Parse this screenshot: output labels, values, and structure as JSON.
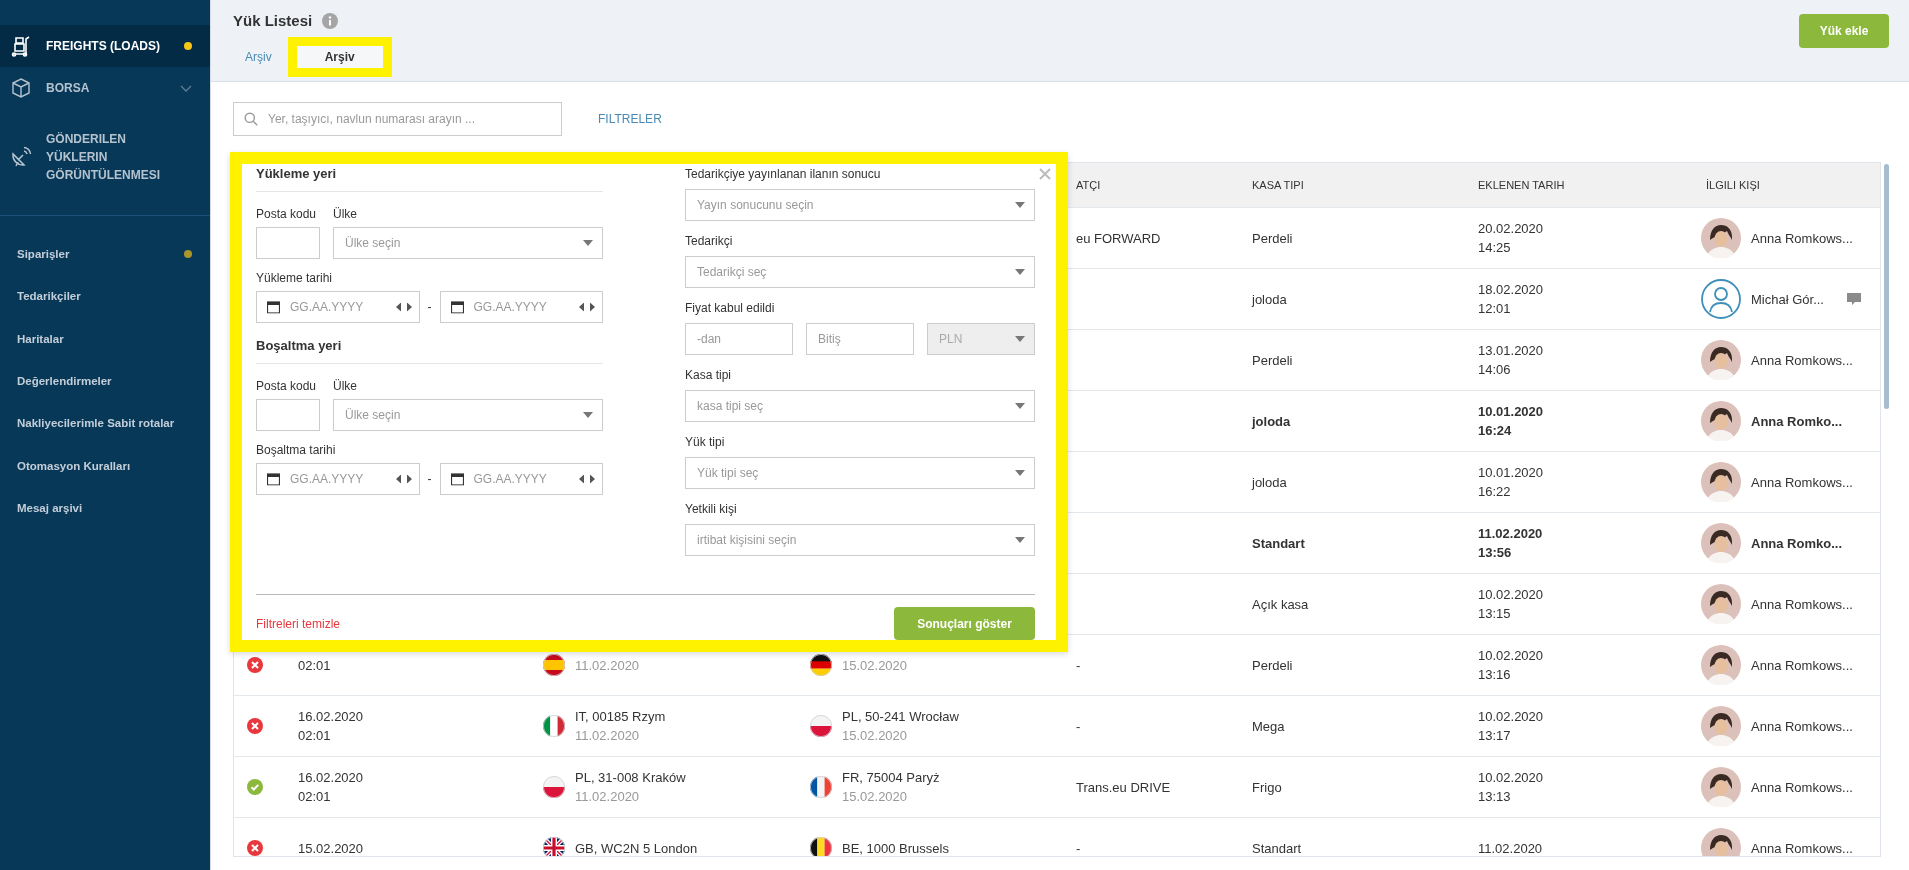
{
  "sidebar": {
    "main_items": [
      {
        "label": "FREIGHTS (LOADS)",
        "selected": true,
        "color": "#f5c518"
      },
      {
        "label": "BORSA",
        "selected": false,
        "expandable": true
      },
      {
        "label": "GÖNDERILEN YÜKLERIN GÖRÜNTÜLENMESI",
        "selected": false
      }
    ],
    "items": [
      {
        "label": "Siparişler",
        "color": "#a8962a"
      },
      {
        "label": "Tedarikçiler"
      },
      {
        "label": "Haritalar"
      },
      {
        "label": "Değerlendirmeler"
      },
      {
        "label": "Nakliyecilerimle Sabit rotalar"
      },
      {
        "label": "Otomasyon Kuralları"
      },
      {
        "label": "Mesaj arşivi"
      }
    ]
  },
  "header": {
    "title": "Yük Listesi",
    "add_button": "Yük ekle",
    "tabs": [
      {
        "label": "Arşiv",
        "selected": false,
        "highlighted": false
      },
      {
        "label": "Arşiv",
        "selected": true,
        "highlighted": true
      }
    ]
  },
  "search": {
    "placeholder": "Yer, taşıyıcı, navlun numarası arayın ...",
    "filters_link": "FILTRELER"
  },
  "filter_panel": {
    "highlighted": true,
    "left_sections": [
      {
        "title": "Yükleme yeri",
        "postcode_label": "Posta kodu",
        "country_label": "Ülke",
        "country_placeholder": "Ülke seçin",
        "date_label": "Yükleme tarihi",
        "date_from_placeholder": "GG.AA.YYYY",
        "separator": "-",
        "date_to_placeholder": "GG.AA.YYYY"
      },
      {
        "title": "Boşaltma yeri",
        "postcode_label": "Posta kodu",
        "country_label": "Ülke",
        "country_placeholder": "Ülke seçin",
        "date_label": "Boşaltma tarihi",
        "date_from_placeholder": "GG.AA.YYYY",
        "separator": "-",
        "date_to_placeholder": "GG.AA.YYYY"
      }
    ],
    "right_fields": [
      {
        "kind": "select",
        "label": "Tedarikçiye yayınlanan ilanın sonucu",
        "placeholder": "Yayın sonucunu seçin"
      },
      {
        "kind": "select",
        "label": "Tedarikçi",
        "placeholder": "Tedarikçi seç"
      },
      {
        "kind": "range",
        "label": "Fiyat kabul edildi",
        "from_placeholder": "-dan",
        "to_placeholder": "Bitiş",
        "currency": {
          "value": "PLN",
          "disabled": true
        }
      },
      {
        "kind": "select",
        "label": "Kasa tipi",
        "placeholder": "kasa tipi seç"
      },
      {
        "kind": "select",
        "label": "Yük tipi",
        "placeholder": "Yük tipi seç"
      },
      {
        "kind": "select",
        "label": "Yetkili kişi",
        "placeholder": "irtibat kişisini seçin"
      }
    ],
    "clear_link": "Filtreleri temizle",
    "submit_button": "Sonuçları göster"
  },
  "table": {
    "headers": [
      "ATÇI",
      "KASA TIPI",
      "EKLENEN TARIH",
      "İLGILI KIŞI"
    ],
    "rows": [
      {
        "unread": false,
        "carrier": "eu FORWARD",
        "body_type": "Perdeli",
        "added": [
          "20.02.2020",
          "14:25"
        ],
        "contact": {
          "name": "Anna Romkows...",
          "kind": "photo",
          "has_comment": false
        }
      },
      {
        "unread": false,
        "body_type": "joloda",
        "added": [
          "18.02.2020",
          "12:01"
        ],
        "contact": {
          "name": "Michał Gór...",
          "kind": "placeholder",
          "has_comment": true
        }
      },
      {
        "unread": false,
        "body_type": "Perdeli",
        "added": [
          "13.01.2020",
          "14:06"
        ],
        "contact": {
          "name": "Anna Romkows...",
          "kind": "photo",
          "has_comment": false
        }
      },
      {
        "unread": true,
        "body_type": "joloda",
        "added": [
          "10.01.2020",
          "16:24"
        ],
        "contact": {
          "name": "Anna Romko...",
          "kind": "photo",
          "has_comment": false
        }
      },
      {
        "unread": false,
        "body_type": "joloda",
        "added": [
          "10.01.2020",
          "16:22"
        ],
        "contact": {
          "name": "Anna Romkows...",
          "kind": "photo",
          "has_comment": false
        }
      },
      {
        "unread": true,
        "body_type": "Standart",
        "added": [
          "11.02.2020",
          "13:56"
        ],
        "contact": {
          "name": "Anna Romko...",
          "kind": "photo",
          "has_comment": false
        }
      },
      {
        "unread": false,
        "body_type": "Açık kasa",
        "added": [
          "10.02.2020",
          "13:15"
        ],
        "contact": {
          "name": "Anna Romkows...",
          "kind": "photo",
          "has_comment": false
        }
      },
      {
        "unread": false,
        "accepted": false,
        "loading_date": [
          "02:01"
        ],
        "from": {
          "kind": "es",
          "date": "11.02.2020"
        },
        "to": {
          "kind": "de",
          "date": "15.02.2020"
        },
        "carrier": "-",
        "body_type": "Perdeli",
        "added": [
          "10.02.2020",
          "13:16"
        ],
        "contact": {
          "name": "Anna Romkows...",
          "kind": "photo",
          "has_comment": false
        }
      },
      {
        "unread": false,
        "accepted": false,
        "loading_date": [
          "16.02.2020",
          "02:01"
        ],
        "from": {
          "kind": "it",
          "place": "IT, 00185 Rzym",
          "date": "11.02.2020"
        },
        "to": {
          "kind": "pl",
          "place": "PL, 50-241 Wrocław",
          "date": "15.02.2020"
        },
        "carrier": "-",
        "body_type": "Mega",
        "added": [
          "10.02.2020",
          "13:17"
        ],
        "contact": {
          "name": "Anna Romkows...",
          "kind": "photo",
          "has_comment": false
        }
      },
      {
        "unread": false,
        "accepted": true,
        "loading_date": [
          "16.02.2020",
          "02:01"
        ],
        "from": {
          "kind": "pl",
          "place": "PL, 31-008 Kraków",
          "date": "11.02.2020"
        },
        "to": {
          "kind": "fr",
          "place": "FR, 75004 Paryż",
          "date": "15.02.2020"
        },
        "carrier": "Trans.eu DRIVE",
        "body_type": "Frigo",
        "added": [
          "10.02.2020",
          "13:13"
        ],
        "contact": {
          "name": "Anna Romkows...",
          "kind": "photo",
          "has_comment": false
        }
      },
      {
        "unread": false,
        "accepted": false,
        "loading_date": [
          "15.02.2020"
        ],
        "from": {
          "kind": "gb",
          "place": "GB, WC2N 5 London"
        },
        "to": {
          "kind": "be",
          "place": "BE, 1000 Brussels"
        },
        "carrier": "-",
        "body_type": "Standart",
        "added": [
          "11.02.2020"
        ],
        "contact": {
          "name": "Anna Romkows...",
          "kind": "photo",
          "has_comment": false
        }
      }
    ]
  }
}
